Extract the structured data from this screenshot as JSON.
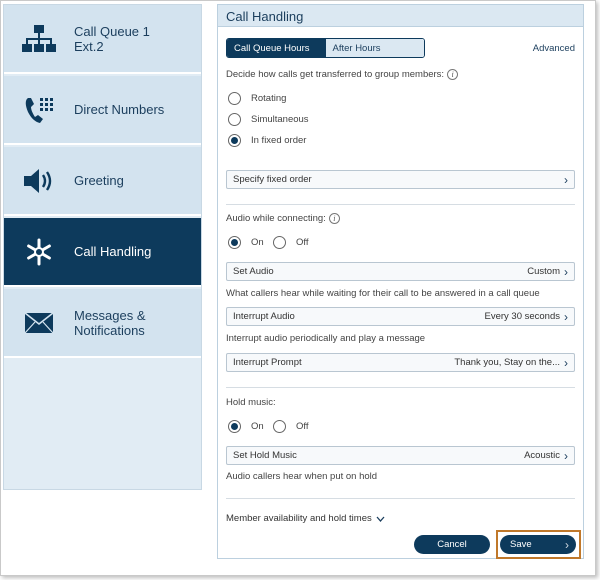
{
  "sidebar": {
    "items": [
      {
        "label": "Call Queue 1\nExt.2",
        "icon": "org-chart-icon"
      },
      {
        "label": "Direct Numbers",
        "icon": "phone-keypad-icon"
      },
      {
        "label": "Greeting",
        "icon": "speaker-icon"
      },
      {
        "label": "Call Handling",
        "icon": "asterisk-icon",
        "active": true
      },
      {
        "label": "Messages &\nNotifications",
        "icon": "envelope-icon"
      }
    ]
  },
  "panel": {
    "title": "Call Handling",
    "tabs": [
      {
        "label": "Call Queue Hours",
        "active": true
      },
      {
        "label": "After Hours",
        "active": false
      }
    ],
    "advanced_label": "Advanced",
    "transfer_prompt": "Decide how calls get transferred to group members:",
    "transfer_options": [
      {
        "label": "Rotating",
        "selected": false
      },
      {
        "label": "Simultaneous",
        "selected": false
      },
      {
        "label": "In fixed order",
        "selected": true
      }
    ],
    "specify_fixed_order": "Specify fixed order",
    "audio_connecting_label": "Audio while connecting:",
    "audio_on": "On",
    "audio_off": "Off",
    "set_audio": {
      "label": "Set Audio",
      "value": "Custom"
    },
    "set_audio_desc": "What callers hear while waiting for their call to be answered in a call queue",
    "interrupt_audio": {
      "label": "Interrupt Audio",
      "value": "Every 30 seconds"
    },
    "interrupt_audio_desc": "Interrupt audio periodically and play a message",
    "interrupt_prompt": {
      "label": "Interrupt Prompt",
      "value": "Thank you, Stay on the..."
    },
    "hold_music_label": "Hold music:",
    "hold_on": "On",
    "hold_off": "Off",
    "set_hold_music": {
      "label": "Set Hold Music",
      "value": "Acoustic"
    },
    "hold_music_desc": "Audio callers hear when put on hold",
    "member_availability": "Member availability and hold times",
    "cancel_label": "Cancel",
    "save_label": "Save"
  },
  "colors": {
    "navy": "#0d3a5c",
    "sidebar_bg": "#d3e3ef",
    "highlight": "#c0782a"
  }
}
